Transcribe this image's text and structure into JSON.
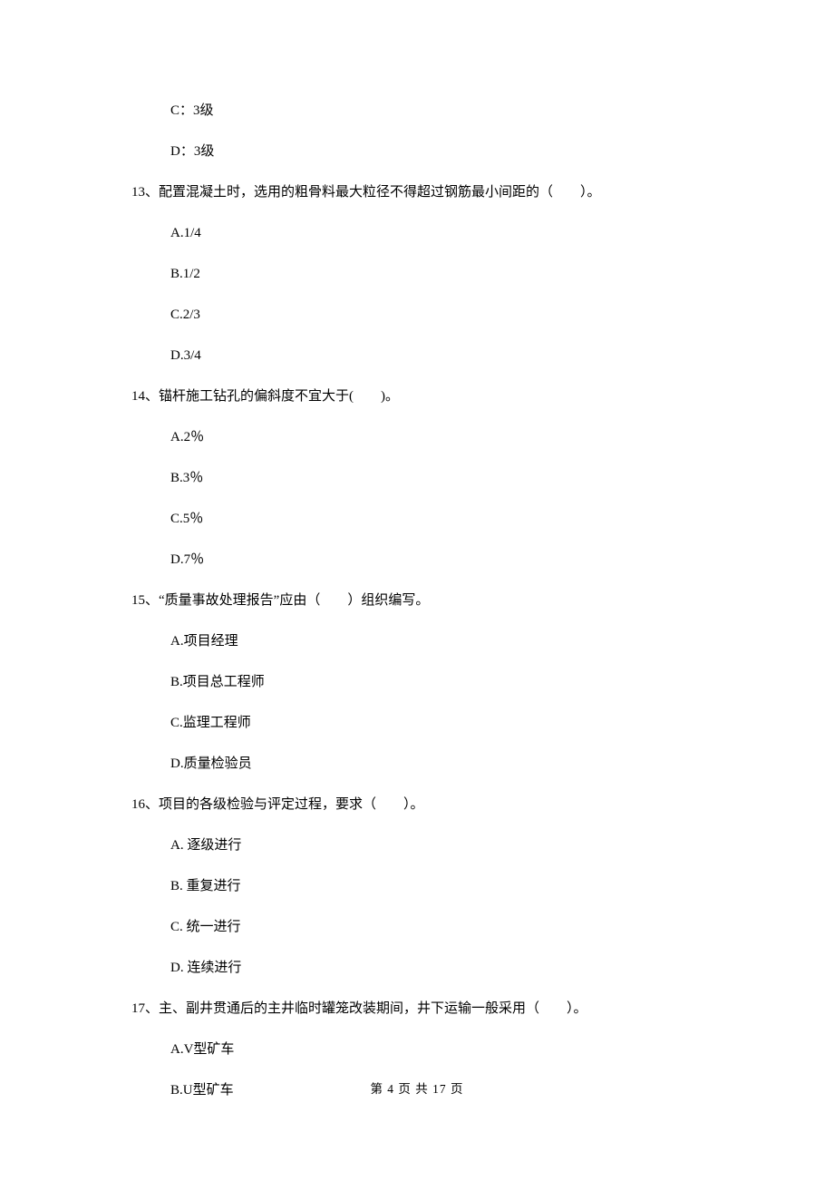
{
  "prelude_options": {
    "c": "C：3级",
    "d": "D：3级"
  },
  "q13": {
    "stem": "13、配置混凝土时，选用的粗骨料最大粒径不得超过钢筋最小间距的（　　）。",
    "a": "A.1/4",
    "b": "B.1/2",
    "c": "C.2/3",
    "d": "D.3/4"
  },
  "q14": {
    "stem": "14、锚杆施工钻孔的偏斜度不宜大于(　　)。",
    "a": "A.2％",
    "b": "B.3％",
    "c": "C.5％",
    "d": "D.7％"
  },
  "q15": {
    "stem": "15、“质量事故处理报告”应由（　　）组织编写。",
    "a": "A.项目经理",
    "b": "B.项目总工程师",
    "c": "C.监理工程师",
    "d": "D.质量检验员"
  },
  "q16": {
    "stem": "16、项目的各级检验与评定过程，要求（　　）。",
    "a": "A. 逐级进行",
    "b": "B. 重复进行",
    "c": "C. 统一进行",
    "d": "D. 连续进行"
  },
  "q17": {
    "stem": "17、主、副井贯通后的主井临时罐笼改装期间，井下运输一般采用（　　）。",
    "a": "A.V型矿车",
    "b": "B.U型矿车"
  },
  "footer": "第 4 页 共 17 页"
}
